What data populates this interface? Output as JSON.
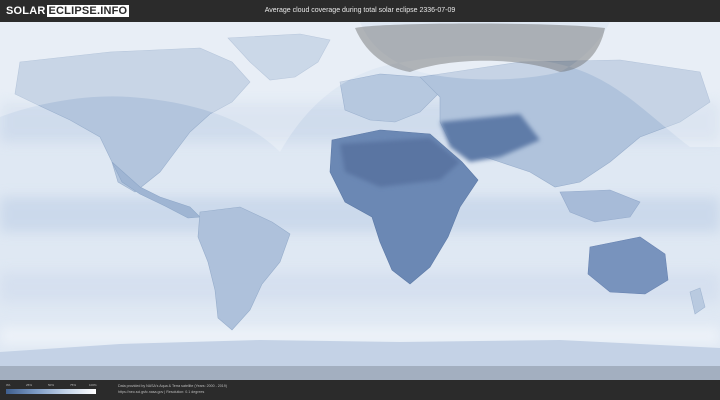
{
  "header": {
    "logo_part1": "SOLAR",
    "logo_part2": "ECLIPSE.INFO",
    "title": "Average cloud coverage during total solar eclipse 2336-07-09"
  },
  "legend": {
    "ticks": [
      "0%",
      "25%",
      "50%",
      "75%",
      "100%"
    ],
    "colors": [
      "#3f5f8e",
      "#7d9cc6",
      "#c3d4e9",
      "#ffffff"
    ]
  },
  "credits": {
    "line1": "Data provided by NASA's Aqua & Terra satellite (Years: 2000 - 2019)",
    "line2": "https://neo.sci.gsfc.nasa.gov | Resolution: 0.1 degrees"
  },
  "colors": {
    "ocean": "#dde7f2",
    "land": "#adbfd8",
    "dark_land": "#5c79a6",
    "shadow": "#6b6b6b",
    "frame": "#2b2b2b"
  }
}
